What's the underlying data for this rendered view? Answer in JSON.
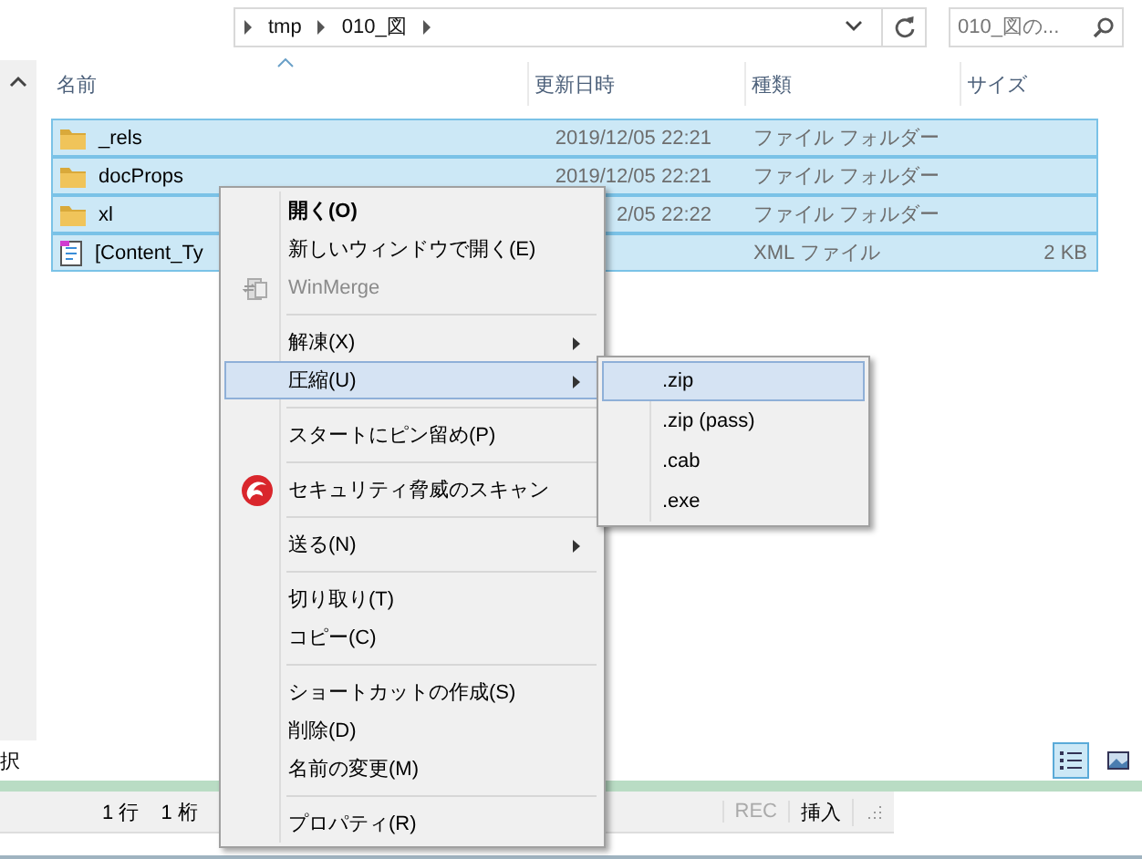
{
  "address": {
    "crumbs": [
      "tmp",
      "010_図"
    ]
  },
  "search": {
    "placeholder": "010_図の..."
  },
  "columns": [
    "名前",
    "更新日時",
    "種類",
    "サイズ"
  ],
  "files": [
    {
      "name": "_rels",
      "modified": "2019/12/05 22:21",
      "type": "ファイル フォルダー",
      "kind": "folder",
      "selected": true
    },
    {
      "name": "docProps",
      "modified": "2019/12/05 22:21",
      "type": "ファイル フォルダー",
      "kind": "folder",
      "selected": true
    },
    {
      "name": "xl",
      "modified": "2/05 22:22",
      "type": "ファイル フォルダー",
      "kind": "folder",
      "selected": true
    },
    {
      "name": "[Content_Ty",
      "type": "XML ファイル",
      "size": "2 KB",
      "kind": "xml",
      "selected": true
    }
  ],
  "status_bar": {
    "text": "択"
  },
  "editor_status": {
    "line": "1 行",
    "column": "1 桁",
    "rec": "REC",
    "mode": "挿入"
  },
  "context_menu": {
    "items": [
      {
        "kind": "item",
        "label": "開く(O)",
        "bold": true,
        "disabled": false,
        "submenu": false,
        "selected": false
      },
      {
        "kind": "item",
        "label": "新しいウィンドウで開く(E)",
        "bold": false,
        "disabled": false,
        "submenu": false,
        "selected": false
      },
      {
        "kind": "app",
        "label": "WinMerge",
        "bold": false,
        "disabled": true,
        "submenu": false,
        "selected": false
      },
      {
        "kind": "separator"
      },
      {
        "kind": "item",
        "label": "解凍(X)",
        "bold": false,
        "disabled": false,
        "submenu": true,
        "selected": false
      },
      {
        "kind": "item",
        "label": "圧縮(U)",
        "bold": false,
        "disabled": false,
        "submenu": true,
        "selected": true
      },
      {
        "kind": "separator"
      },
      {
        "kind": "item",
        "label": "スタートにピン留め(P)",
        "bold": false,
        "disabled": false,
        "submenu": false,
        "selected": false
      },
      {
        "kind": "separator"
      },
      {
        "kind": "scan",
        "label": "セキュリティ脅威のスキャン",
        "bold": false,
        "disabled": false,
        "submenu": false,
        "selected": false
      },
      {
        "kind": "separator"
      },
      {
        "kind": "item",
        "label": "送る(N)",
        "bold": false,
        "disabled": false,
        "submenu": true,
        "selected": false
      },
      {
        "kind": "separator"
      },
      {
        "kind": "item",
        "label": "切り取り(T)",
        "bold": false,
        "disabled": false,
        "submenu": false,
        "selected": false
      },
      {
        "kind": "item",
        "label": "コピー(C)",
        "bold": false,
        "disabled": false,
        "submenu": false,
        "selected": false
      },
      {
        "kind": "separator"
      },
      {
        "kind": "item",
        "label": "ショートカットの作成(S)",
        "bold": false,
        "disabled": false,
        "submenu": false,
        "selected": false
      },
      {
        "kind": "item",
        "label": "削除(D)",
        "bold": false,
        "disabled": false,
        "submenu": false,
        "selected": false
      },
      {
        "kind": "item",
        "label": "名前の変更(M)",
        "bold": false,
        "disabled": false,
        "submenu": false,
        "selected": false
      },
      {
        "kind": "separator"
      },
      {
        "kind": "item",
        "label": "プロパティ(R)",
        "bold": false,
        "disabled": false,
        "submenu": false,
        "selected": false
      }
    ]
  },
  "submenu": {
    "items": [
      {
        "label": ".zip",
        "selected": true
      },
      {
        "label": ".zip (pass)",
        "selected": false
      },
      {
        "label": ".cab",
        "selected": false
      },
      {
        "label": ".exe",
        "selected": false
      }
    ]
  }
}
